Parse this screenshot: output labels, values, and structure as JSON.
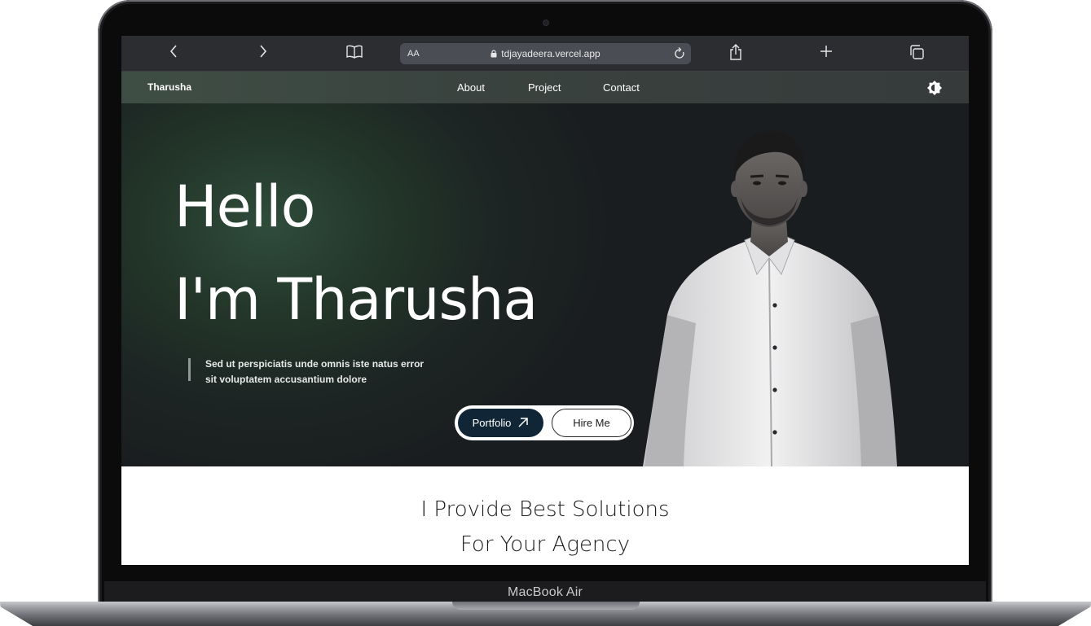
{
  "device": {
    "label": "MacBook Air"
  },
  "browser": {
    "back_icon": "chevron-left-icon",
    "forward_icon": "chevron-right-icon",
    "reader_icon": "book-icon",
    "aa_label": "AA",
    "url": "tdjayadeera.vercel.app",
    "share_icon": "share-icon",
    "new_tab_icon": "plus-icon",
    "tabs_icon": "tabs-icon"
  },
  "nav": {
    "brand": "Tharusha",
    "links": [
      "About",
      "Project",
      "Contact"
    ],
    "theme_icon": "theme-toggle-icon"
  },
  "hero": {
    "greeting": "Hello",
    "intro": "I'm Tharusha",
    "subtitle_line1": "Sed ut perspiciatis unde omnis iste natus error",
    "subtitle_line2": "sit voluptatem accusantium dolore",
    "portfolio_label": "Portfolio",
    "hire_label": "Hire Me"
  },
  "solutions": {
    "line1": "I Provide Best Solutions",
    "line2": "For Your Agency"
  },
  "colors": {
    "hero_green": "#2f4c3b",
    "portfolio_button": "#102636",
    "nav_bg": "#3a433f"
  }
}
